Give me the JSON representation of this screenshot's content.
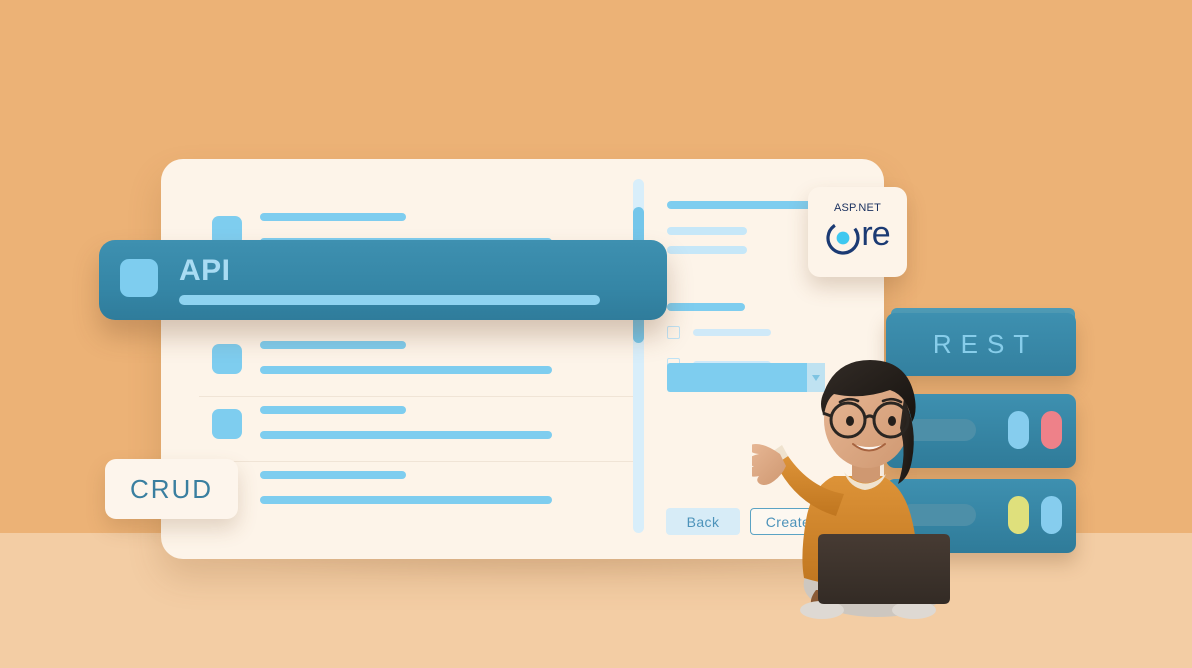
{
  "theme": {
    "background": "#ecb276",
    "floor": "#f3cda4",
    "card_bg": "#fdf4e9",
    "accent_teal": "#3586a6",
    "accent_light_blue": "#7ecdef",
    "text_blue": "#3a7fa0"
  },
  "card": {
    "rows": [
      {
        "id": "row-1",
        "highlighted": false
      },
      {
        "id": "row-2",
        "highlighted": false
      },
      {
        "id": "row-3",
        "highlighted": false
      },
      {
        "id": "row-4",
        "highlighted": false
      }
    ],
    "highlighted_row": {
      "label": "API"
    },
    "scrollbar": {
      "orientation": "vertical"
    },
    "form": {
      "checkbox_count": 2,
      "select_value": "",
      "buttons": {
        "back": "Back",
        "create": "Create"
      }
    }
  },
  "badges": {
    "aspnet": {
      "top_text": "ASP.NET",
      "core_text": "re",
      "full_name": "ASP.NET Core"
    },
    "crud": {
      "label": "CRUD"
    },
    "rest": {
      "label": "REST"
    }
  },
  "servers": [
    {
      "id": "server-top",
      "pills": [
        "#86cdee",
        "#ee8189"
      ]
    },
    {
      "id": "server-bottom",
      "pills": [
        "#dfe07c",
        "#86cdee"
      ]
    }
  ],
  "character": {
    "description": "woman-with-laptop-pointing",
    "skin": "#dda683",
    "sweater": "#d4872f",
    "hair": "#231f1c",
    "laptop": "#3d332c",
    "pants": "#cfc9c2"
  }
}
